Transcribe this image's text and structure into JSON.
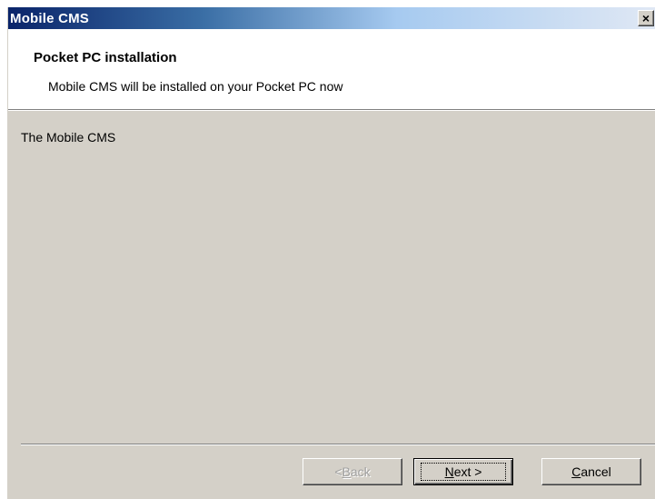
{
  "window": {
    "title": "Mobile CMS",
    "close_glyph": "×"
  },
  "header": {
    "title": "Pocket PC installation",
    "subtitle": "Mobile CMS will be installed on your Pocket PC now"
  },
  "body": {
    "text": "The Mobile CMS"
  },
  "buttons": {
    "back": {
      "mnemonic": "B",
      "rest": "ack",
      "prefix": "< ",
      "enabled": false
    },
    "next": {
      "mnemonic": "N",
      "rest": "ext >",
      "enabled": true,
      "default": true
    },
    "cancel": {
      "mnemonic": "C",
      "rest": "ancel",
      "enabled": true
    }
  }
}
